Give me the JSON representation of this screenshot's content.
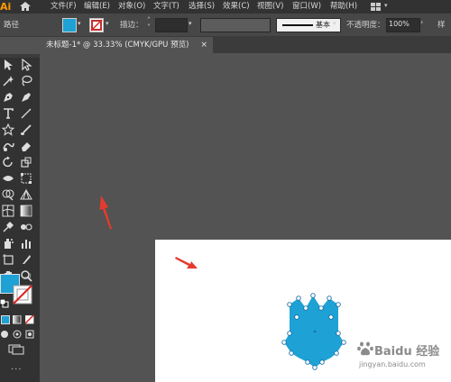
{
  "app": {
    "logo": "Ai"
  },
  "menus": [
    "文件(F)",
    "编辑(E)",
    "对象(O)",
    "文字(T)",
    "选择(S)",
    "效果(C)",
    "视图(V)",
    "窗口(W)",
    "帮助(H)"
  ],
  "control_bar": {
    "path_label": "路径",
    "stroke_label": "描边：",
    "stroke_style_label": "基本",
    "opacity_label": "不透明度：",
    "opacity_value": "100%",
    "fill_color": "#1ea1d4",
    "overflow_label": "样"
  },
  "document_tab": {
    "title": "未标题-1* @ 33.33% (CMYK/GPU 预览)",
    "close": "×"
  },
  "toolbar": {
    "fill_color": "#1ea1d4",
    "more_label": "..."
  },
  "canvas": {
    "artboard_color": "#ffffff",
    "shape_color": "#1ea1d4",
    "annotation_color": "#e63a2e"
  },
  "watermark": {
    "text": "Baidu 经验",
    "url": "jingyan.baidu.com"
  }
}
